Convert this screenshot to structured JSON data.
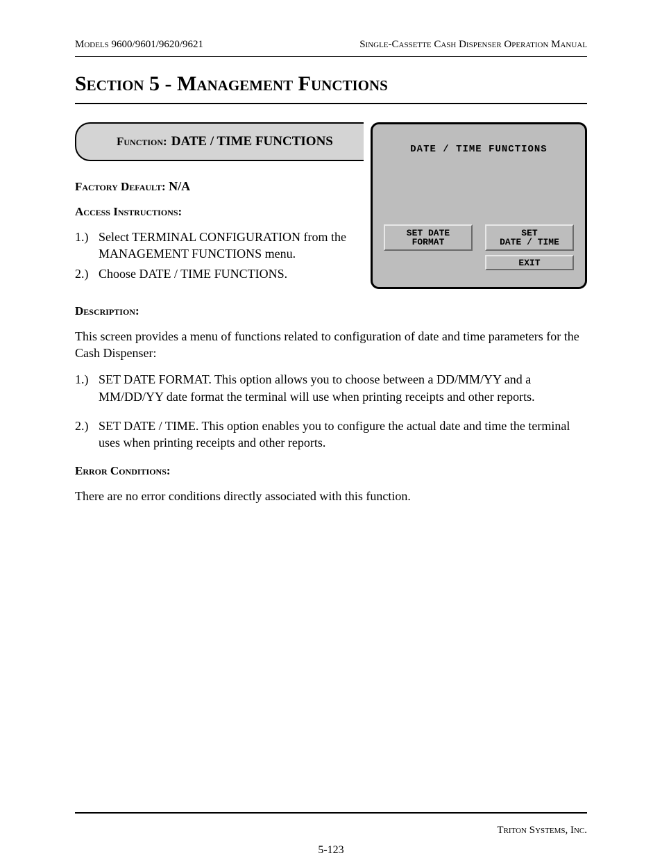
{
  "header": {
    "models_label": "Models",
    "models_value": "9600/9601/9620/9621",
    "manual_title": "Single-Cassette Cash Dispenser Operation Manual"
  },
  "section_title": "Section 5 - Management Functions",
  "function_bar": {
    "label": "Function:",
    "value": "DATE / TIME FUNCTIONS"
  },
  "terminal": {
    "title": "DATE / TIME FUNCTIONS",
    "btn_left": "SET DATE\nFORMAT",
    "btn_right_top": "SET\nDATE / TIME",
    "btn_right_bot": "EXIT"
  },
  "factory_default": {
    "label": "Factory Default:",
    "value": "N/A"
  },
  "access_instructions": {
    "label": "Access Instructions:",
    "items": [
      {
        "num": "1.)",
        "text": "Select TERMINAL CONFIGURATION from the MANAGEMENT FUNCTIONS menu."
      },
      {
        "num": "2.)",
        "text": "Choose DATE / TIME FUNCTIONS."
      }
    ]
  },
  "description": {
    "label": "Description:",
    "intro": "This screen provides a menu of functions related to configuration of date and time parameters for the Cash Dispenser:",
    "items": [
      {
        "num": "1.)",
        "text": "SET DATE FORMAT. This option allows you to choose between a DD/MM/YY and a MM/DD/YY date format the terminal will use when printing receipts and other reports."
      },
      {
        "num": "2.)",
        "text": "SET DATE / TIME. This option enables you  to configure the actual date and time the terminal uses when printing receipts and other reports."
      }
    ]
  },
  "error_conditions": {
    "label": "Error Conditions:",
    "text": "There are no error conditions directly associated with this function."
  },
  "footer": {
    "company": "Triton Systems, Inc.",
    "page": "5-123"
  }
}
